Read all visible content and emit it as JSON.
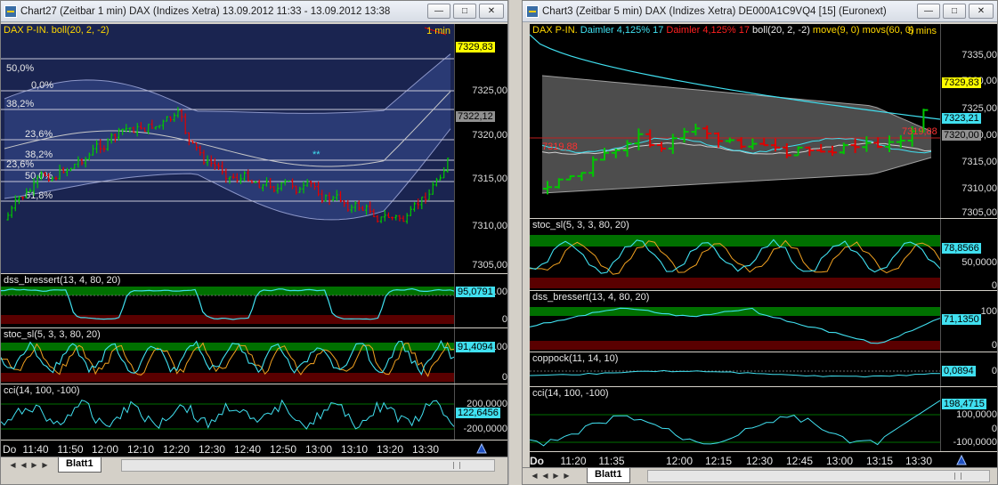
{
  "left_window": {
    "title": "Chart27 (Zeitbar 1 min)  DAX (Indizes Xetra) 13.09.2012 11:33 - 13.09.2012 13:38",
    "main_panel": {
      "title": "DAX P-IN. boll(20, 2, -2)",
      "interval": "1 min",
      "y_labels": [
        "7305,00",
        "7310,00",
        "7315,00",
        "7320,00",
        "7325,00"
      ],
      "price_tag": "7329,83",
      "boll_tag": "7322,12",
      "fib_labels": [
        "50,0%",
        "0,0%",
        "38,2%",
        "23,6%",
        "38,2%",
        "23,6%",
        "50,0%",
        "61,8%"
      ],
      "overlay_mark": "**"
    },
    "dss_panel": {
      "title": "dss_bressert(13, 4, 80, 20)",
      "value_tag": "95,0791",
      "y_labels": [
        "100",
        "0"
      ]
    },
    "stoc_panel": {
      "title": "stoc_sl(5, 3, 3, 80, 20)",
      "value_tag": "91,4094",
      "y_labels": [
        "100",
        "0"
      ]
    },
    "cci_panel": {
      "title": "cci(14, 100, -100)",
      "value_tag": "122,6456",
      "y_labels": [
        "200,0000",
        "-200,0000"
      ]
    },
    "x_labels": [
      "Do",
      "11:40",
      "11:50",
      "12:00",
      "12:10",
      "12:20",
      "12:30",
      "12:40",
      "12:50",
      "13:00",
      "13:10",
      "13:20",
      "13:30"
    ],
    "sheet_tab": "Blatt1"
  },
  "right_window": {
    "title": "Chart3 (Zeitbar 5 min)  DAX (Indizes Xetra) DE000A1C9VQ4 [15] (Euronext)",
    "main_panel": {
      "title_parts": [
        "DAX P-IN.",
        "Daimler  4,125% 17",
        "Daimler  4,125% 17",
        "boll(20, 2, -2)",
        "move(9, 0)",
        "movs(60, 0)"
      ],
      "interval": "5 mins",
      "y_labels": [
        "7305,00",
        "7310,00",
        "7315,00",
        "7320,00",
        "7325,00",
        "7330,00",
        "7335,00"
      ],
      "price_tag": "7329,83",
      "boll_tag": "7323,21",
      "ma_tag": "7320,00",
      "line_labels": [
        "7319,88",
        "7319,88"
      ]
    },
    "stoc_panel": {
      "title": "stoc_sl(5, 3, 3, 80, 20)",
      "value_tag": "78,8566",
      "y_labels": [
        "50,0000",
        "0"
      ]
    },
    "dss_panel": {
      "title": "dss_bressert(13, 4, 80, 20)",
      "value_tag": "71,1350",
      "y_labels": [
        "100",
        "0"
      ]
    },
    "coppock_panel": {
      "title": "coppock(11, 14, 10)",
      "value_tag": "0,0894",
      "y_labels": [
        "0"
      ]
    },
    "cci_panel": {
      "title": "cci(14, 100, -100)",
      "value_tag": "198,4715",
      "y_labels": [
        "100,0000",
        "0",
        "-100,0000"
      ]
    },
    "x_labels": [
      "Do",
      "11:20",
      "11:35",
      "12:00",
      "12:15",
      "12:30",
      "12:45",
      "13:00",
      "13:15",
      "13:30"
    ],
    "sheet_tab": "Blatt1"
  },
  "colors": {
    "bull": "#00c800",
    "bear": "#e00000",
    "osc_cyan": "#40e0f0",
    "osc_orange": "#f0a020",
    "band_left": "#2c3d78",
    "band_right": "#5a5a5a",
    "tag_yellow": "#ffff00",
    "tag_cyan": "#40e0f0",
    "tag_grey": "#909090",
    "zone_green": "#007000",
    "zone_red": "#5a0000"
  }
}
